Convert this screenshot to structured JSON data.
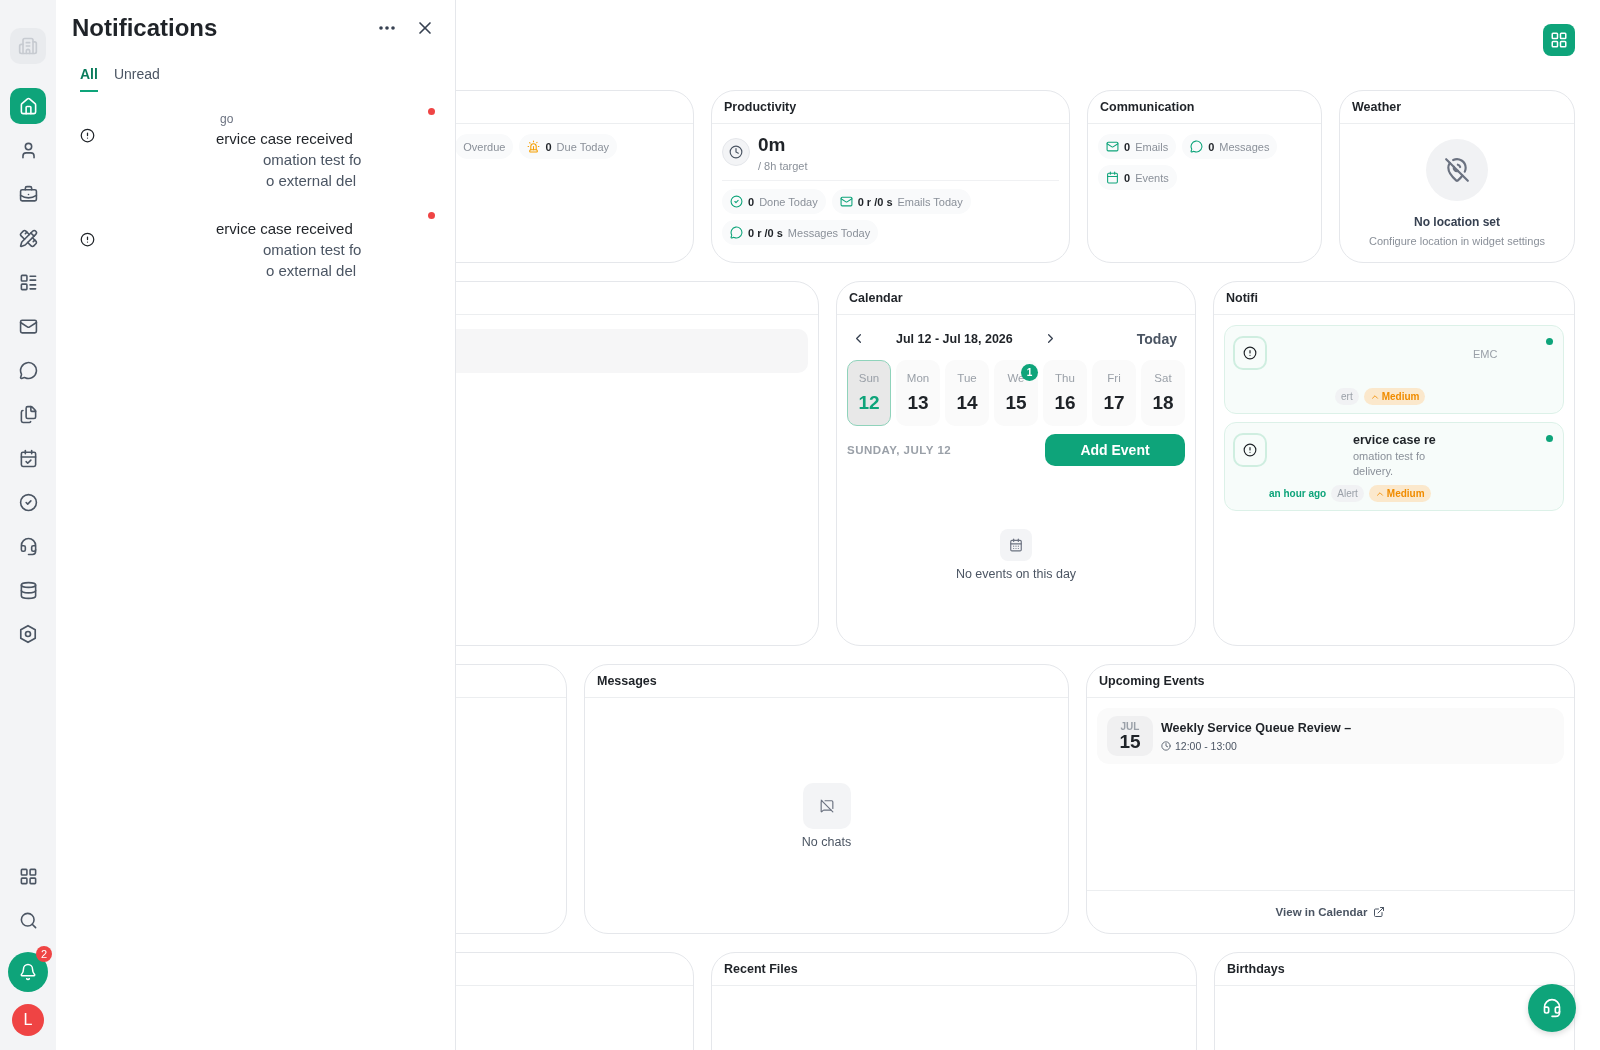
{
  "sidebar": {
    "items": [
      {
        "selected": true
      },
      {
        "selected": false
      },
      {
        "selected": false
      },
      {
        "selected": false
      },
      {
        "selected": false
      },
      {
        "selected": false
      },
      {
        "selected": false
      },
      {
        "selected": false
      },
      {
        "selected": false
      },
      {
        "selected": false
      },
      {
        "selected": false
      },
      {
        "selected": false
      },
      {
        "selected": false
      }
    ],
    "bell_badge": "2",
    "avatar": "L"
  },
  "notification_panel": {
    "title": "Notifications",
    "tabs": [
      {
        "label": "All",
        "selected": true
      },
      {
        "label": "Unread",
        "selected": false
      }
    ],
    "items": [
      {
        "time": "go",
        "title": "ervice case received",
        "lines": [
          "omation test fo",
          "o external del"
        ],
        "unread": true
      },
      {
        "title": "ervice case received",
        "lines": [
          "omation test fo",
          "o external del"
        ],
        "unread": true
      }
    ]
  },
  "tasks_card": {
    "chips": [
      {
        "kind": "overdue",
        "label": "Overdue"
      },
      {
        "kind": "due",
        "value": "0",
        "label": "Due Today"
      }
    ]
  },
  "productivity": {
    "title": "Productivity",
    "time": "0m",
    "target": "/ 8h target",
    "chips": [
      {
        "kind": "done",
        "value": "0",
        "label": "Done Today"
      },
      {
        "kind": "mail",
        "value": "0 r /0 s",
        "label": "Emails Today"
      },
      {
        "kind": "chat",
        "value": "0 r /0 s",
        "label": "Messages Today"
      }
    ]
  },
  "communication": {
    "title": "Communication",
    "chips": [
      {
        "kind": "mail",
        "value": "0",
        "label": "Emails"
      },
      {
        "kind": "chat",
        "value": "0",
        "label": "Messages"
      },
      {
        "kind": "calendar",
        "value": "0",
        "label": "Events"
      }
    ]
  },
  "weather": {
    "title": "Weather",
    "message": "No location set",
    "hint": "Configure location in widget settings"
  },
  "calendar": {
    "title": "Calendar",
    "range": "Jul 12 - Jul 18, 2026",
    "today_button": "Today",
    "days": [
      {
        "weekday": "Sun",
        "date": "12",
        "selected": true
      },
      {
        "weekday": "Mon",
        "date": "13",
        "selected": false
      },
      {
        "weekday": "Tue",
        "date": "14",
        "selected": false
      },
      {
        "weekday": "We",
        "date": "15",
        "selected": false,
        "badge": "1"
      },
      {
        "weekday": "Thu",
        "date": "16",
        "selected": false
      },
      {
        "weekday": "Fri",
        "date": "17",
        "selected": false
      },
      {
        "weekday": "Sat",
        "date": "18",
        "selected": false
      }
    ],
    "selected_date": "SUNDAY, JULY 12",
    "add_button": "Add Event",
    "empty": "No events on this day"
  },
  "notifications_widget": {
    "title": "Notifi",
    "items": [
      {
        "text": "EMC",
        "chips": [
          {
            "kind": "type",
            "label": "ert"
          },
          {
            "kind": "priority",
            "label": "Medium"
          }
        ],
        "unread": true
      },
      {
        "title": "ervice case re",
        "lines": [
          "omation test fo",
          "delivery."
        ],
        "time": "an hour ago",
        "chips": [
          {
            "kind": "type",
            "label": "Alert"
          },
          {
            "kind": "priority",
            "label": "Medium"
          }
        ],
        "unread": true
      }
    ]
  },
  "messages": {
    "title": "Messages",
    "empty": "No chats"
  },
  "upcoming": {
    "title": "Upcoming Events",
    "events": [
      {
        "month": "JUL",
        "day": "15",
        "title": "Weekly Service Queue Review –",
        "time": "12:00 - 13:00"
      }
    ],
    "footer_link": "View in Calendar"
  },
  "recent_files": {
    "title": "Recent Files"
  },
  "birthdays": {
    "title": "Birthdays"
  }
}
